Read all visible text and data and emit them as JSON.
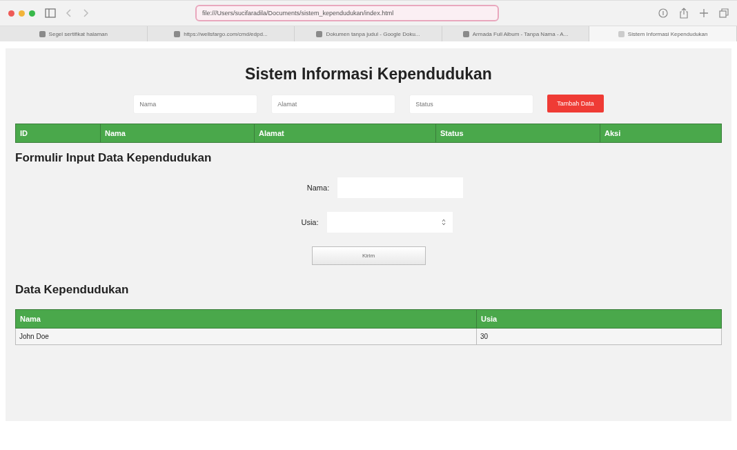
{
  "browser": {
    "url": "file:///Users/sucifaradila/Documents/sistem_kependudukan/index.html",
    "tabs": [
      {
        "label": "Segel sertifikat halaman",
        "selected": false
      },
      {
        "label": "https://wellsfargo.com/cmd/edpd...",
        "selected": false
      },
      {
        "label": "Dokumen tanpa judul - Google Doku...",
        "selected": false
      },
      {
        "label": "Armada Full Album - Tanpa Nama - A...",
        "selected": false
      },
      {
        "label": "Sistem Informasi Kependudukan",
        "selected": true
      }
    ]
  },
  "page": {
    "title": "Sistem Informasi Kependudukan",
    "filters": [
      {
        "placeholder": "Nama"
      },
      {
        "placeholder": "Alamat"
      },
      {
        "placeholder": "Status"
      }
    ],
    "add_button": "Tambah Data",
    "table": {
      "columns": [
        "ID",
        "Nama",
        "Alamat",
        "Status",
        "Aksi"
      ]
    },
    "form": {
      "title": "Formulir Input Data Kependudukan",
      "fields": [
        {
          "label": "Nama:",
          "kind": "text"
        },
        {
          "label": "Usia:",
          "kind": "number"
        }
      ],
      "submit": "Kirim"
    },
    "data": {
      "title": "Data Kependudukan",
      "columns": [
        "Nama",
        "Usia"
      ],
      "rows": [
        [
          "John Doe",
          "30"
        ]
      ]
    }
  }
}
